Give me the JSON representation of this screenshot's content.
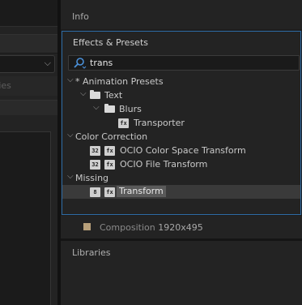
{
  "left_panel": {
    "props_label": "ties",
    "dropdown_chevron": "chevron-down"
  },
  "info_panel": {
    "title": "Info"
  },
  "effects_panel": {
    "title": "Effects & Presets",
    "search": {
      "value": "trans",
      "icon": "search-icon"
    },
    "tree": [
      {
        "label": "* Animation Presets",
        "type": "category",
        "depth": 0,
        "expanded": true
      },
      {
        "label": "Text",
        "type": "folder",
        "depth": 1,
        "expanded": true
      },
      {
        "label": "Blurs",
        "type": "folder",
        "depth": 2,
        "expanded": true
      },
      {
        "label": "Transporter",
        "type": "preset",
        "depth": 3
      },
      {
        "label": "Color Correction",
        "type": "category",
        "depth": 0,
        "expanded": true
      },
      {
        "label": "OCIO Color Space Transform",
        "type": "effect",
        "depth": 1,
        "badges": [
          "32",
          "fx"
        ]
      },
      {
        "label": "OCIO File Transform",
        "type": "effect",
        "depth": 1,
        "badges": [
          "32",
          "fx"
        ]
      },
      {
        "label": "Missing",
        "type": "category",
        "depth": 0,
        "expanded": true
      },
      {
        "label": "Transform",
        "type": "effect",
        "depth": 1,
        "badges": [
          "8",
          "fx"
        ],
        "selected": true
      }
    ]
  },
  "composition": {
    "label": "Composition",
    "resolution": "1920x495",
    "swatch_color": "#b8a07a"
  },
  "libraries_panel": {
    "title": "Libraries"
  },
  "colors": {
    "focus_border": "#2d6ba5",
    "panel_bg": "#232323",
    "selection_bg": "#5a5a5a"
  }
}
